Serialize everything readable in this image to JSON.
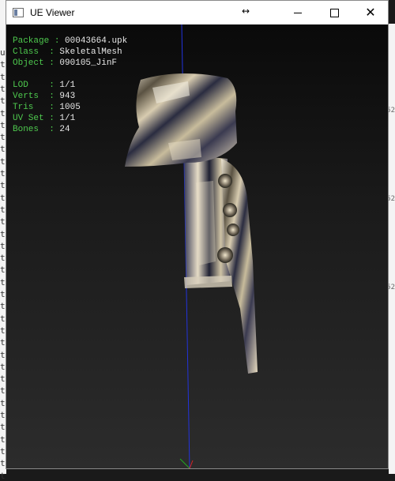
{
  "window": {
    "title": "UE Viewer"
  },
  "stats": {
    "group1": [
      {
        "key": "Package",
        "value": "00043664.upk"
      },
      {
        "key": "Class  ",
        "value": "SkeletalMesh"
      },
      {
        "key": "Object ",
        "value": "090105_JinF"
      }
    ],
    "group2": [
      {
        "key": "LOD    ",
        "value": "1/1"
      },
      {
        "key": "Verts  ",
        "value": "943"
      },
      {
        "key": "Tris   ",
        "value": "1005"
      },
      {
        "key": "UV Set ",
        "value": "1/1"
      },
      {
        "key": "Bones  ",
        "value": "24"
      }
    ]
  },
  "colors": {
    "label_green": "#4ec94e",
    "axis_y": "#2233dd",
    "axis_x": "#dd2222",
    "axis_z": "#22aa22"
  },
  "icons": [
    "app-icon",
    "resize-arrow-icon",
    "minimize-icon",
    "maximize-icon",
    "close-icon"
  ],
  "background_text": {
    "left_glyphs": [
      "u",
      "t",
      "t",
      "t",
      "t",
      "t",
      "t",
      "t",
      "t",
      "t",
      "t",
      "t",
      "t",
      "t",
      "t",
      "t",
      "t",
      "t",
      "t",
      "t",
      "t",
      "t",
      "t",
      "t",
      "t",
      "t",
      "t",
      "t",
      "t",
      "t",
      "t",
      "t",
      "t",
      "t",
      "t",
      "t"
    ],
    "right_glyphs": [
      "52",
      "52",
      "52"
    ]
  }
}
